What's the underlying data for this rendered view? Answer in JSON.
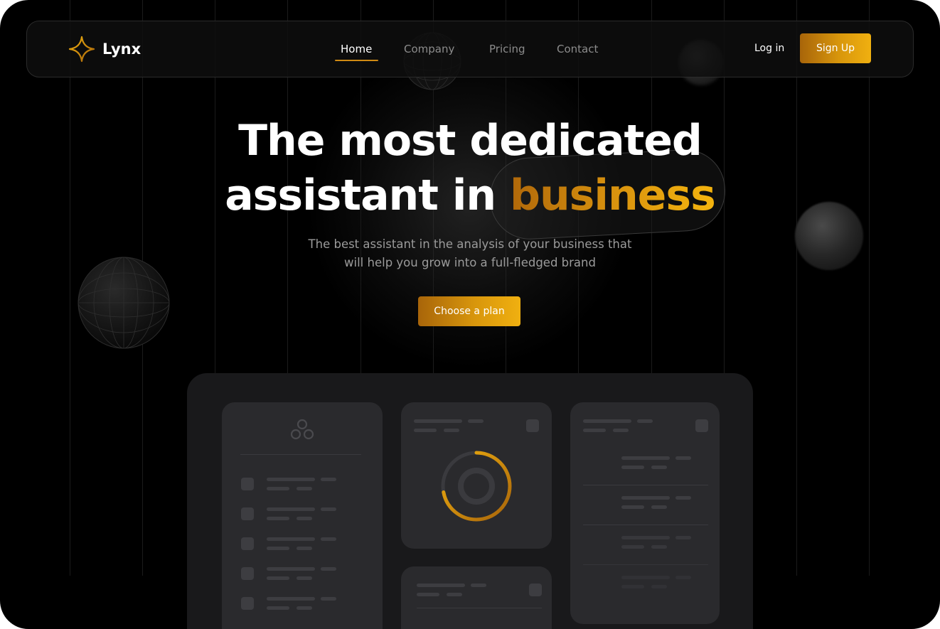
{
  "brand": {
    "name": "Lynx",
    "icon": "sparkle-star-icon",
    "accent": "#d8960c"
  },
  "nav": {
    "items": [
      {
        "label": "Home",
        "active": true
      },
      {
        "label": "Company",
        "active": false
      },
      {
        "label": "Pricing",
        "active": false
      },
      {
        "label": "Contact",
        "active": false
      }
    ],
    "login_label": "Log in",
    "signup_label": "Sign Up"
  },
  "hero": {
    "title_line1": "The most dedicated",
    "title_line2_prefix": "assistant in",
    "title_highlight": "business",
    "subtitle_line1": "The best assistant in the analysis of your business that",
    "subtitle_line2": "will help you grow into a full-fledged brand",
    "cta_label": "Choose a plan"
  },
  "dashboard_preview": {
    "logo_icon": "clover-icon",
    "donut_progress": 0.72
  }
}
